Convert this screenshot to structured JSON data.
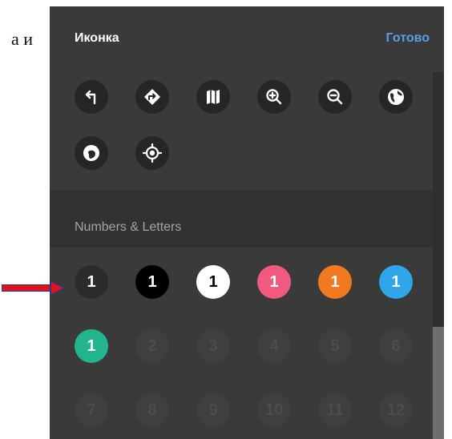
{
  "document": {
    "fragment_text": "а и"
  },
  "panel": {
    "title": "Иконка",
    "done_label": "Готово"
  },
  "sections": {
    "numbers_letters": "Numbers & Letters"
  },
  "icons": [
    {
      "name": "turn-left-arrow-icon"
    },
    {
      "name": "directions-diamond-icon"
    },
    {
      "name": "map-icon"
    },
    {
      "name": "zoom-in-icon"
    },
    {
      "name": "zoom-out-icon"
    },
    {
      "name": "globe-icon"
    },
    {
      "name": "globe-alt-icon"
    },
    {
      "name": "target-crosshair-icon"
    }
  ],
  "number_buttons": [
    {
      "label": "1",
      "bg": "#2b2b2b",
      "color": "#ffffff",
      "selected": true
    },
    {
      "label": "1",
      "bg": "#000000",
      "color": "#ffffff"
    },
    {
      "label": "1",
      "bg": "#ffffff",
      "color": "#000000"
    },
    {
      "label": "1",
      "bg": "#ef5a7e",
      "color": "#ffffff"
    },
    {
      "label": "1",
      "bg": "#f07a20",
      "color": "#ffffff"
    },
    {
      "label": "1",
      "bg": "#2fa6e9",
      "color": "#ffffff"
    },
    {
      "label": "1",
      "bg": "#22b48d",
      "color": "#ffffff"
    },
    {
      "label": "2",
      "disabled": true
    },
    {
      "label": "3",
      "disabled": true
    },
    {
      "label": "4",
      "disabled": true
    },
    {
      "label": "5",
      "disabled": true
    },
    {
      "label": "6",
      "disabled": true
    },
    {
      "label": "7",
      "disabled": true
    },
    {
      "label": "8",
      "disabled": true
    },
    {
      "label": "9",
      "disabled": true
    },
    {
      "label": "10",
      "disabled": true
    },
    {
      "label": "11",
      "disabled": true
    },
    {
      "label": "12",
      "disabled": true
    }
  ],
  "colors": {
    "panel_bg": "#3a3a3a",
    "accent": "#5b9ee5",
    "pointer_arrow": "#e0121b"
  }
}
